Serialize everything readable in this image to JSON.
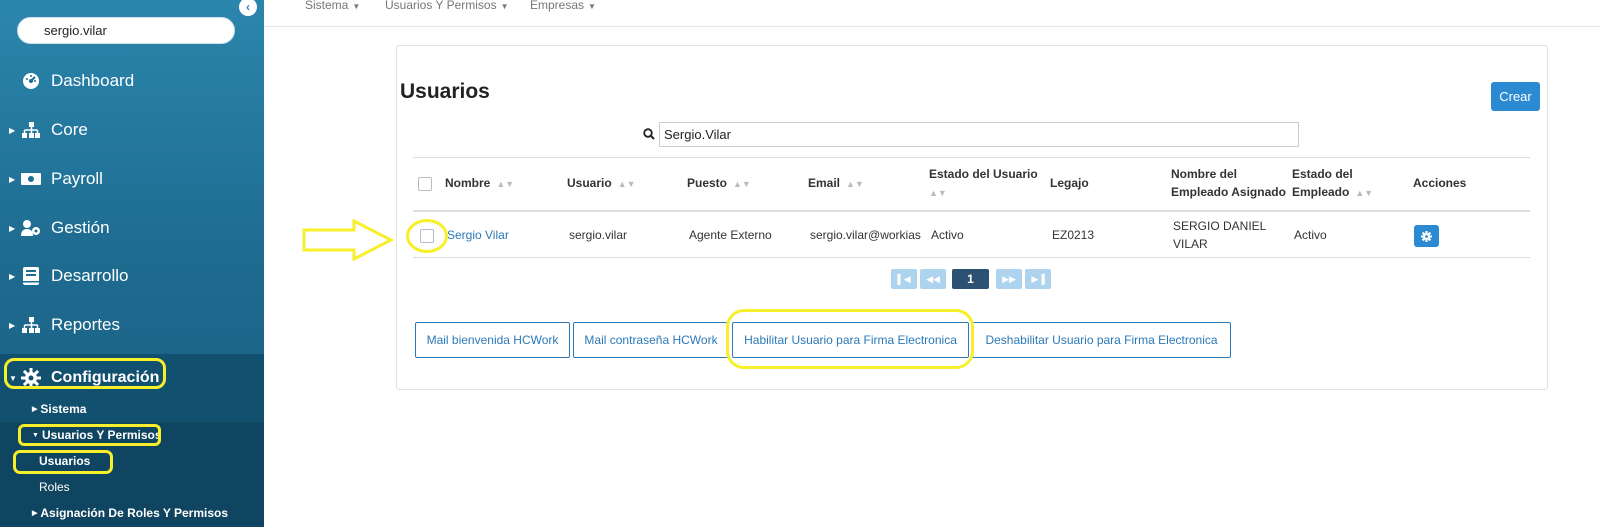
{
  "sidebar": {
    "search_value": "sergio.vilar",
    "items": [
      {
        "label": "Dashboard",
        "icon": "dashboard-icon"
      },
      {
        "label": "Core",
        "icon": "sitemap-icon"
      },
      {
        "label": "Payroll",
        "icon": "money-icon"
      },
      {
        "label": "Gestión",
        "icon": "user-cog-icon"
      },
      {
        "label": "Desarrollo",
        "icon": "book-icon"
      },
      {
        "label": "Reportes",
        "icon": "sitemap-icon"
      },
      {
        "label": "Configuración",
        "icon": "gear-icon"
      }
    ],
    "sub": {
      "sistema": "Sistema",
      "usuarios_permisos": "Usuarios Y Permisos",
      "usuarios": "Usuarios",
      "roles": "Roles",
      "asignacion": "Asignación De Roles Y Permisos"
    }
  },
  "topnav": {
    "items": [
      "Sistema",
      "Usuarios Y Permisos",
      "Empresas"
    ]
  },
  "main": {
    "title": "Usuarios",
    "create_label": "Crear",
    "search_value": "Sergio.Vilar",
    "columns": [
      "Nombre",
      "Usuario",
      "Puesto",
      "Email",
      "Estado del Usuario",
      "Legajo",
      "Nombre del Empleado Asignado",
      "Estado del Empleado",
      "Acciones"
    ],
    "rows": [
      {
        "nombre": "Sergio Vilar",
        "usuario": "sergio.vilar",
        "puesto": "Agente Externo",
        "email": "sergio.vilar@workias",
        "estado_usuario": "Activo",
        "legajo": "EZ0213",
        "empleado": "SERGIO DANIEL VILAR",
        "estado_empleado": "Activo"
      }
    ],
    "pagination": {
      "current": "1"
    },
    "actions": [
      "Mail bienvenida HCWork",
      "Mail contraseña HCWork",
      "Habilitar Usuario para Firma Electronica",
      "Deshabilitar Usuario para Firma Electronica"
    ]
  },
  "colors": {
    "sidebar": "#1f6d92",
    "primary": "#2b8ad1",
    "highlight": "#f6ef2a"
  }
}
